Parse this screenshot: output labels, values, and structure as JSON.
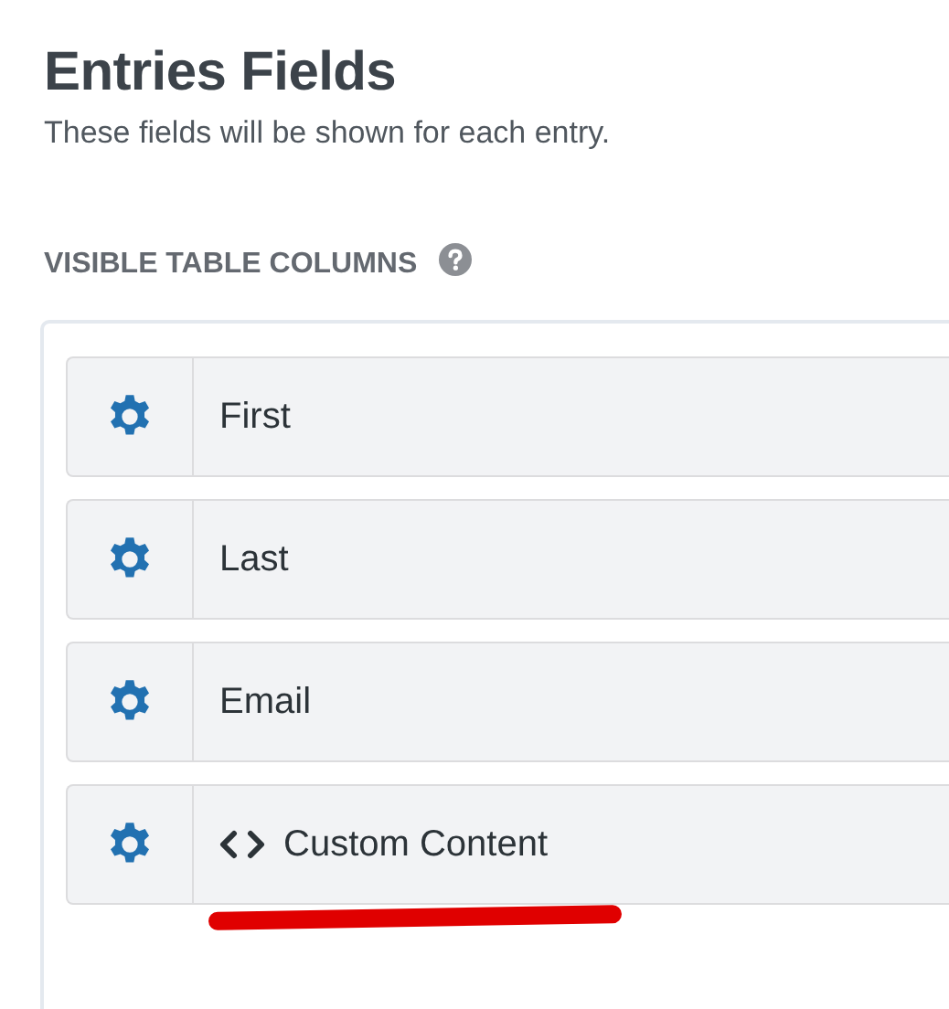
{
  "heading": {
    "title": "Entries Fields",
    "description": "These fields will be shown for each entry."
  },
  "section": {
    "label": "VISIBLE TABLE COLUMNS"
  },
  "columns": [
    {
      "kind": "field",
      "label": "First",
      "underlined": false
    },
    {
      "kind": "field",
      "label": "Last",
      "underlined": false
    },
    {
      "kind": "field",
      "label": "Email",
      "underlined": false
    },
    {
      "kind": "custom",
      "label": "Custom Content",
      "underlined": true
    }
  ]
}
